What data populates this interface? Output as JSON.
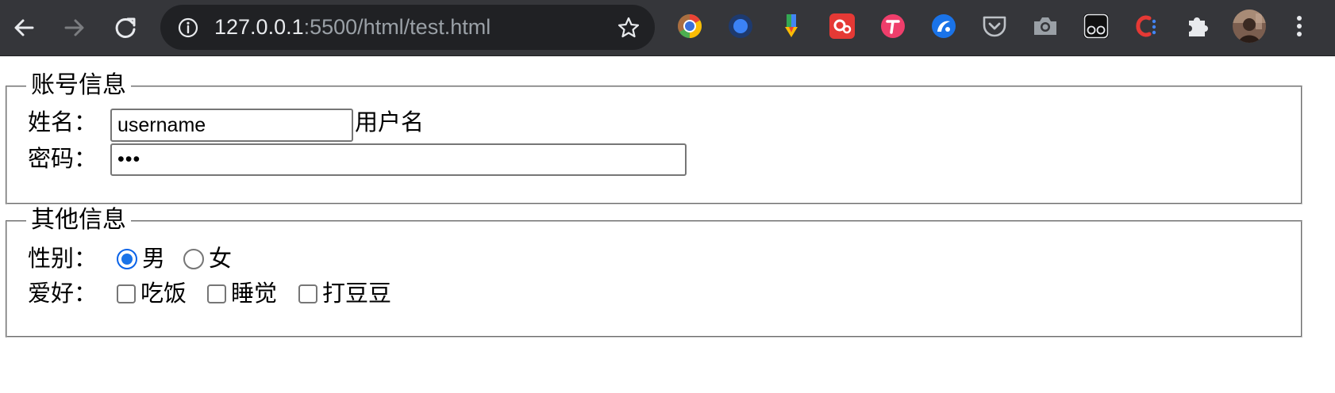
{
  "browser": {
    "url_host": "127.0.0.1",
    "url_path": ":5500/html/test.html",
    "extensions": [
      "chrome-color-icon",
      "blue-dot-extension-icon",
      "bookmark-ribbon-icon",
      "red-gears-extension-icon",
      "pink-t-extension-icon",
      "blue-swirl-extension-icon",
      "pocket-icon",
      "camera-icon",
      "goggles-extension-icon",
      "red-c-extension-icon",
      "puzzle-piece-icon"
    ],
    "colors": {
      "toolbar": "#35363a",
      "omnibox": "#202124",
      "radio_accent": "#1a73e8"
    }
  },
  "form": {
    "account": {
      "legend": "账号信息",
      "name_label": "姓名：",
      "name_value": "username",
      "name_suffix": "用户名",
      "password_label": "密码：",
      "password_mask": "•••"
    },
    "other": {
      "legend": "其他信息",
      "gender_label": "性别：",
      "gender_options": [
        {
          "label": "男",
          "checked": true
        },
        {
          "label": "女",
          "checked": false
        }
      ],
      "hobby_label": "爱好：",
      "hobby_options": [
        {
          "label": "吃饭",
          "checked": false
        },
        {
          "label": "睡觉",
          "checked": false
        },
        {
          "label": "打豆豆",
          "checked": false
        }
      ]
    }
  }
}
